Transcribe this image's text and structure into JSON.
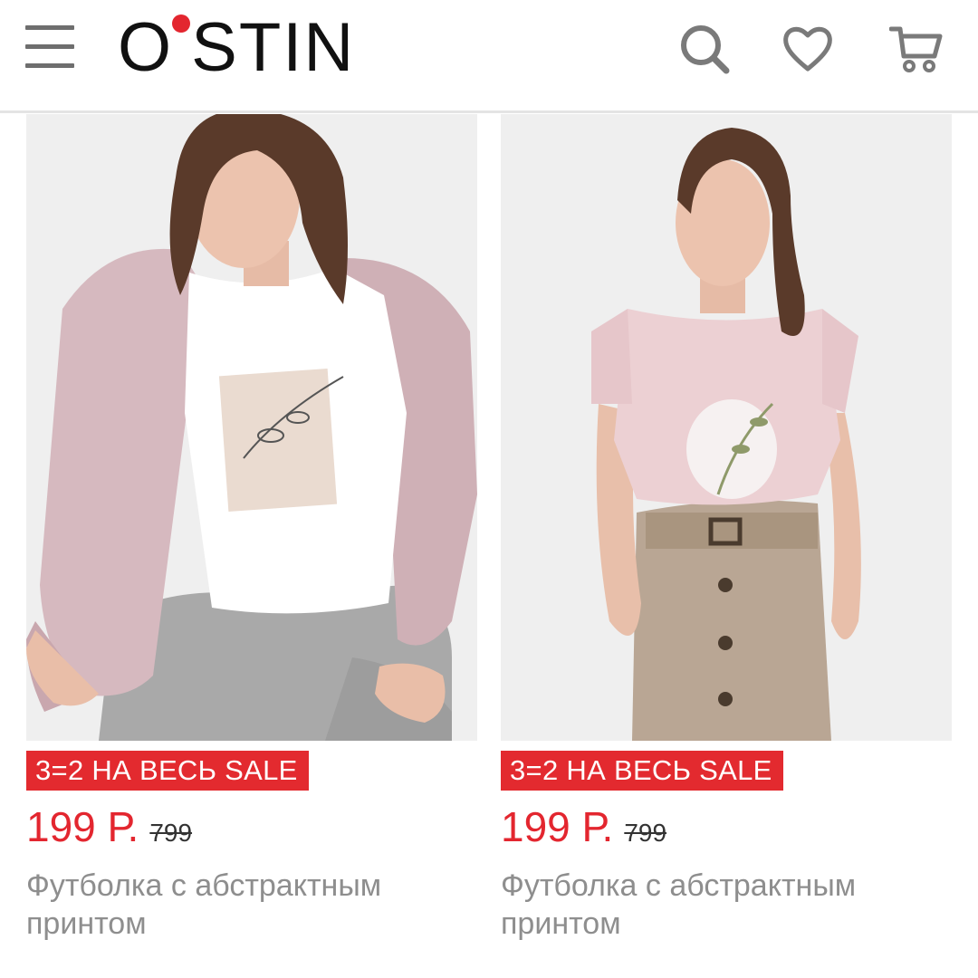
{
  "header": {
    "logo_text": "O'STIN",
    "logo_text_rest": "STIN",
    "logo_letter": "O",
    "brand_color": "#e3262f",
    "icons": [
      "menu-icon",
      "search-icon",
      "heart-icon",
      "cart-icon"
    ]
  },
  "products": [
    {
      "badge": "3=2 НА ВЕСЬ SALE",
      "price": "199 Р.",
      "old_price": "799",
      "title": "Футболка с абстрактным принтом"
    },
    {
      "badge": "3=2 НА ВЕСЬ SALE",
      "price": "199 Р.",
      "old_price": "799",
      "title": "Футболка с абстрактным принтом"
    }
  ],
  "colors": {
    "badge_bg": "#e32a2f",
    "price": "#e3262f",
    "title": "#8e8e8e"
  }
}
